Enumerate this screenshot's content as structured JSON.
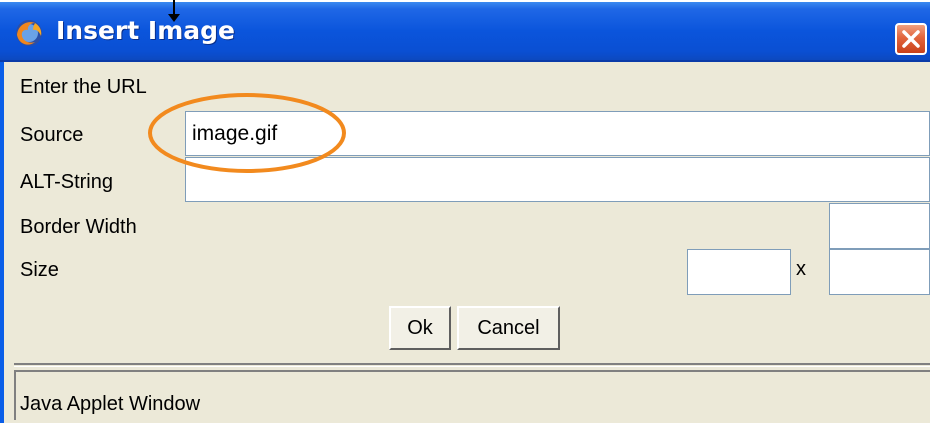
{
  "window": {
    "title": "Insert Image",
    "icon": "firefox-icon",
    "close_icon": "close-icon"
  },
  "form": {
    "heading": "Enter the URL",
    "source_label": "Source",
    "source_value": "image.gif",
    "alt_label": "ALT-String",
    "alt_value": "",
    "border_label": "Border Width",
    "border_value": "",
    "size_label": "Size",
    "size_width_value": "",
    "size_separator": "x",
    "size_height_value": ""
  },
  "buttons": {
    "ok_label": "Ok",
    "cancel_label": "Cancel"
  },
  "status": {
    "text": "Java Applet Window"
  },
  "annotation": {
    "highlight_color": "#f28a1e",
    "cursor_icon": "mouse-cursor-icon"
  },
  "colors": {
    "titlebar": "#0b55dc",
    "dialog_bg": "#ece9d8",
    "close_button": "#e2643c",
    "field_border": "#7f9db9"
  }
}
